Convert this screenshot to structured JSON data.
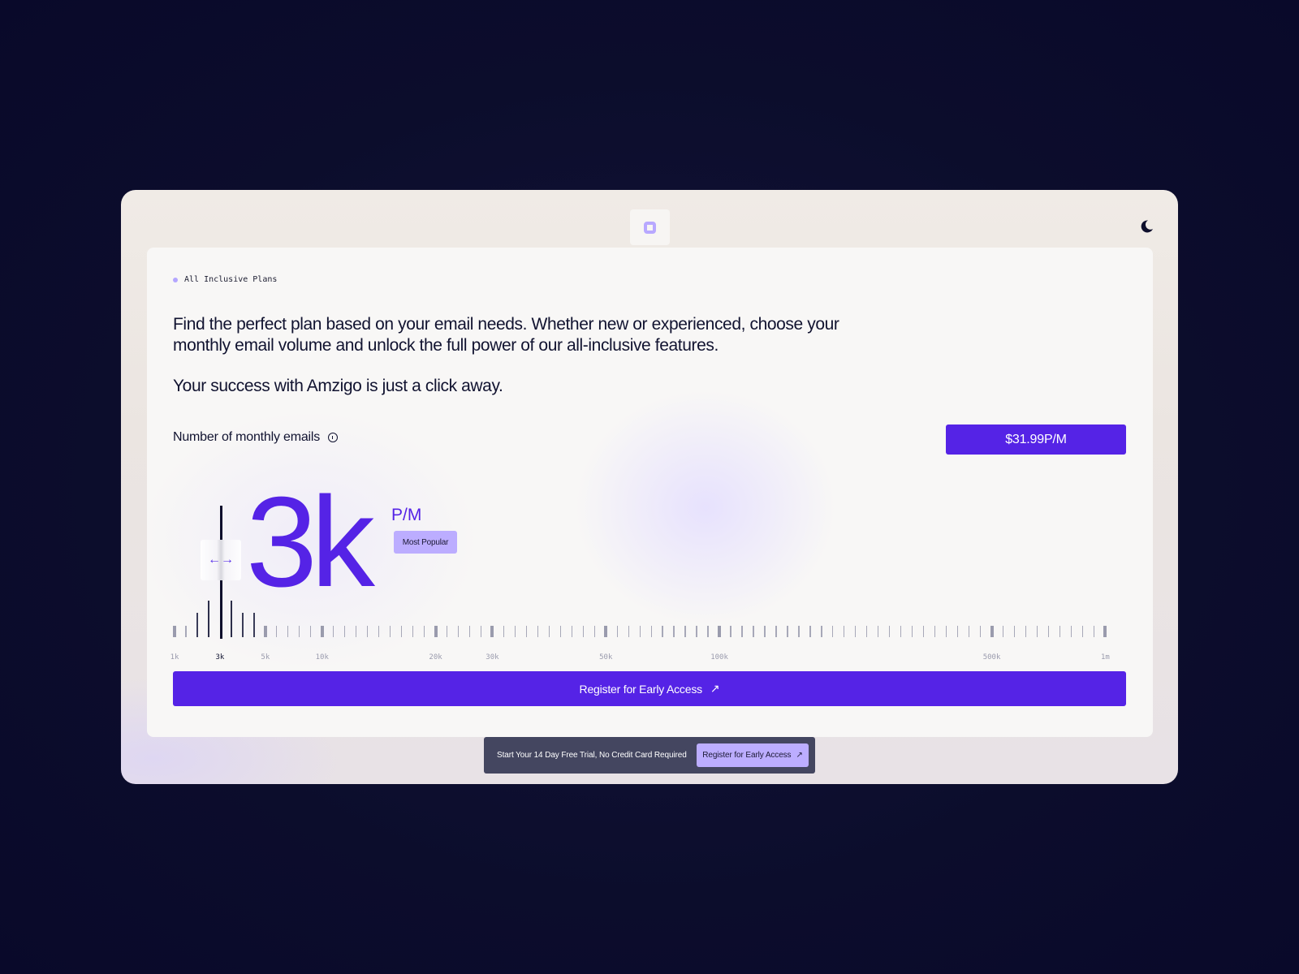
{
  "header": {
    "logo_icon": "logo-square-icon",
    "theme_toggle_icon": "moon-icon"
  },
  "pricing": {
    "eyebrow": "All Inclusive Plans",
    "intro": "Find the perfect plan based on your email needs. Whether new or experienced, choose your monthly email volume and unlock the full power of our all-inclusive features.",
    "tagline": "Your success with Amzigo is just a click away.",
    "emails_label": "Number of monthly emails",
    "info_icon": "info-icon",
    "price": "$31.99P/M",
    "selected_value": "3k",
    "unit": "P/M",
    "badge": "Most Popular",
    "slider": {
      "min": "1k",
      "max": "1m",
      "selected": "3k",
      "handle_icon": "left-right-arrows-icon",
      "labels": [
        "1k",
        "3k",
        "5k",
        "10k",
        "20k",
        "30k",
        "50k",
        "100k",
        "500k",
        "1m"
      ]
    },
    "cta_label": "Register for Early Access",
    "cta_icon": "arrow-up-right-icon"
  },
  "toast": {
    "message": "Start Your 14 Day Free Trial, No Credit Card Required",
    "button_label": "Register for Early Access",
    "button_icon": "arrow-up-right-icon"
  },
  "colors": {
    "accent": "#5523e6",
    "accent_light": "#bcadff",
    "text_dark": "#111330",
    "background": "#0c0d2c"
  }
}
